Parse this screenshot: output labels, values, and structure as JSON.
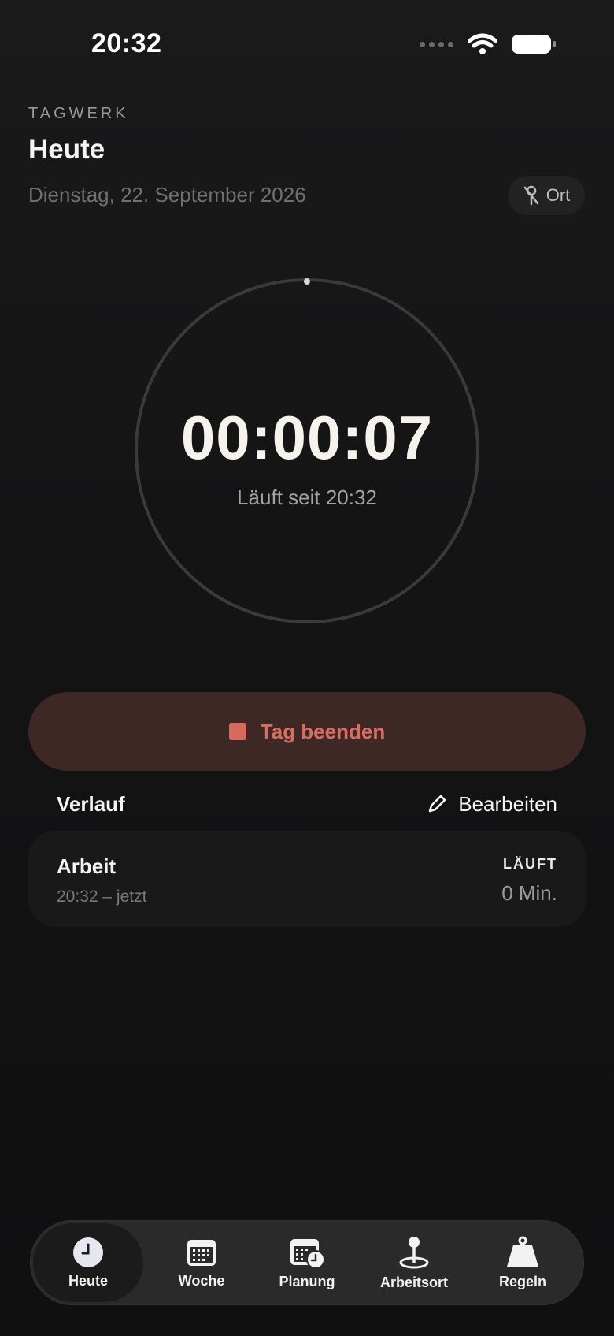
{
  "status_bar": {
    "time": "20:32"
  },
  "header": {
    "brand": "TAGWERK",
    "title": "Heute",
    "date": "Dienstag, 22. September 2026",
    "location_button": "Ort"
  },
  "timer": {
    "value": "00:00:07",
    "subtitle": "Läuft seit 20:32"
  },
  "primary_action": {
    "label": "Tag beenden",
    "color": "#d96d60"
  },
  "history": {
    "title": "Verlauf",
    "edit_label": "Bearbeiten",
    "entries": [
      {
        "title": "Arbeit",
        "time": "20:32 – jetzt",
        "status": "LÄUFT",
        "duration": "0 Min."
      }
    ]
  },
  "tabs": [
    {
      "label": "Heute",
      "icon": "clock-icon",
      "active": true
    },
    {
      "label": "Woche",
      "icon": "calendar-icon",
      "active": false
    },
    {
      "label": "Planung",
      "icon": "calendar-clock-icon",
      "active": false
    },
    {
      "label": "Arbeitsort",
      "icon": "map-pin-icon",
      "active": false
    },
    {
      "label": "Regeln",
      "icon": "weight-icon",
      "active": false
    }
  ]
}
